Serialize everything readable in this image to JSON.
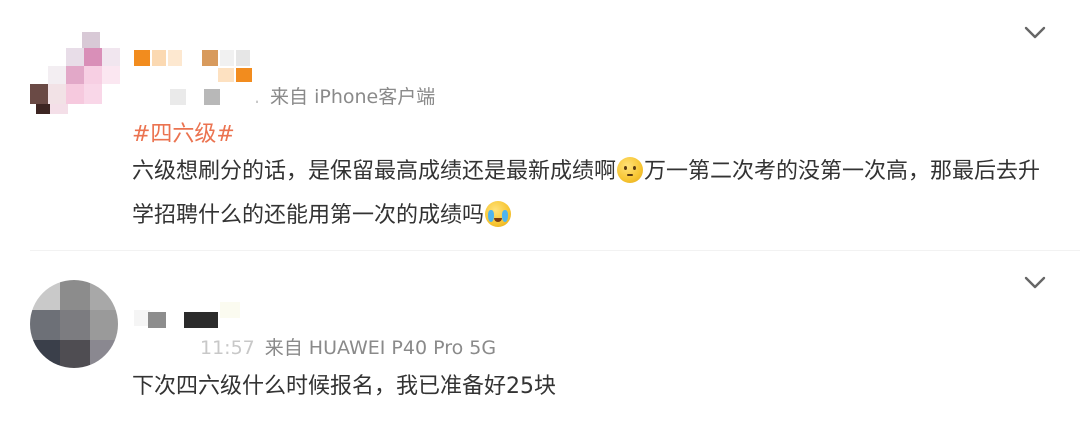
{
  "comments": [
    {
      "source": "来自 iPhone客户端",
      "time_partial": ".",
      "hashtag": "#四六级#",
      "text_part1": "六级想刷分的话，是保留最高成绩还是最新成绩啊",
      "emoji1": "thinking-face",
      "text_part2": "万一第二次考的没第一次高，那最后去升学招聘什么的还能用第一次的成绩吗",
      "emoji2": "crying-face"
    },
    {
      "source": "来自 HUAWEI P40 Pro 5G",
      "time_partial": "11:57",
      "text": "下次四六级什么时候报名，我已准备好25块"
    }
  ],
  "colors": {
    "hashtag": "#eb7350",
    "meta": "#8a8a8a",
    "text": "#333333"
  }
}
